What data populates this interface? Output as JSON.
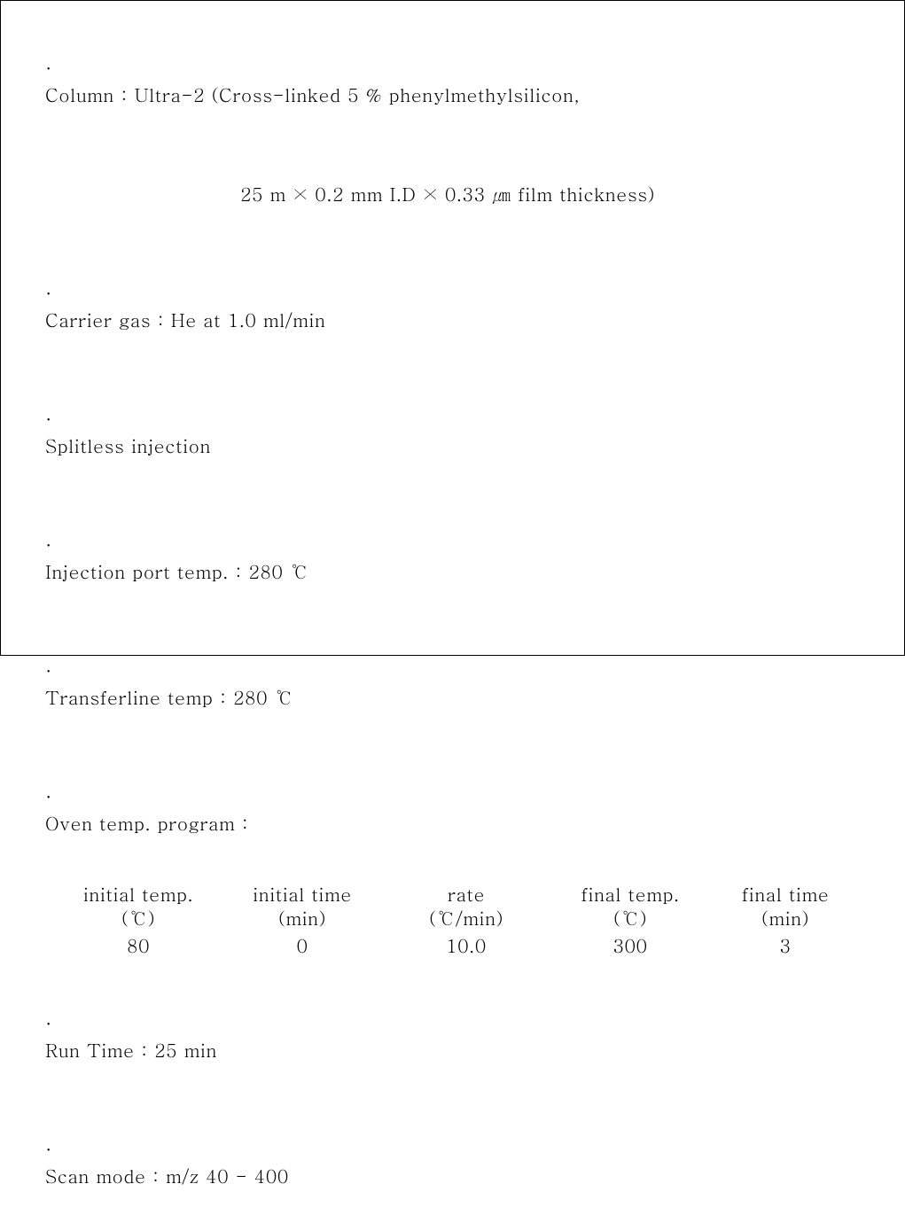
{
  "items": {
    "column_label": "Column : ",
    "column_value_line1": "Ultra-2 (Cross-linked 5 % phenylmethylsilicon,",
    "column_value_line2": "25 m × 0.2 mm I.D × 0.33 ㎛ film thickness)",
    "carrier_gas_label": "Carrier gas : ",
    "carrier_gas_value": "He at 1.0 ml/min",
    "splitless": "Splitless injection",
    "inj_port_label": "Injection port temp. : ",
    "inj_port_value": "280 ℃",
    "transferline_label": "Transferline temp : ",
    "transferline_value": "280 ℃",
    "oven_label": "Oven temp. program :",
    "run_time_label": "Run Time : ",
    "run_time_value": "25 min",
    "scan_mode_label": "Scan mode : ",
    "scan_mode_value": "m/z 40 - 400"
  },
  "oven_table": {
    "headers": [
      {
        "h1": "initial temp.",
        "h2": "(℃)"
      },
      {
        "h1": "initial time",
        "h2": "(min)"
      },
      {
        "h1": "rate",
        "h2": "(℃/min)"
      },
      {
        "h1": "final temp.",
        "h2": "(℃)"
      },
      {
        "h1": "final time",
        "h2": "(min)"
      }
    ],
    "values": [
      "80",
      "0",
      "10.0",
      "300",
      "3"
    ]
  }
}
